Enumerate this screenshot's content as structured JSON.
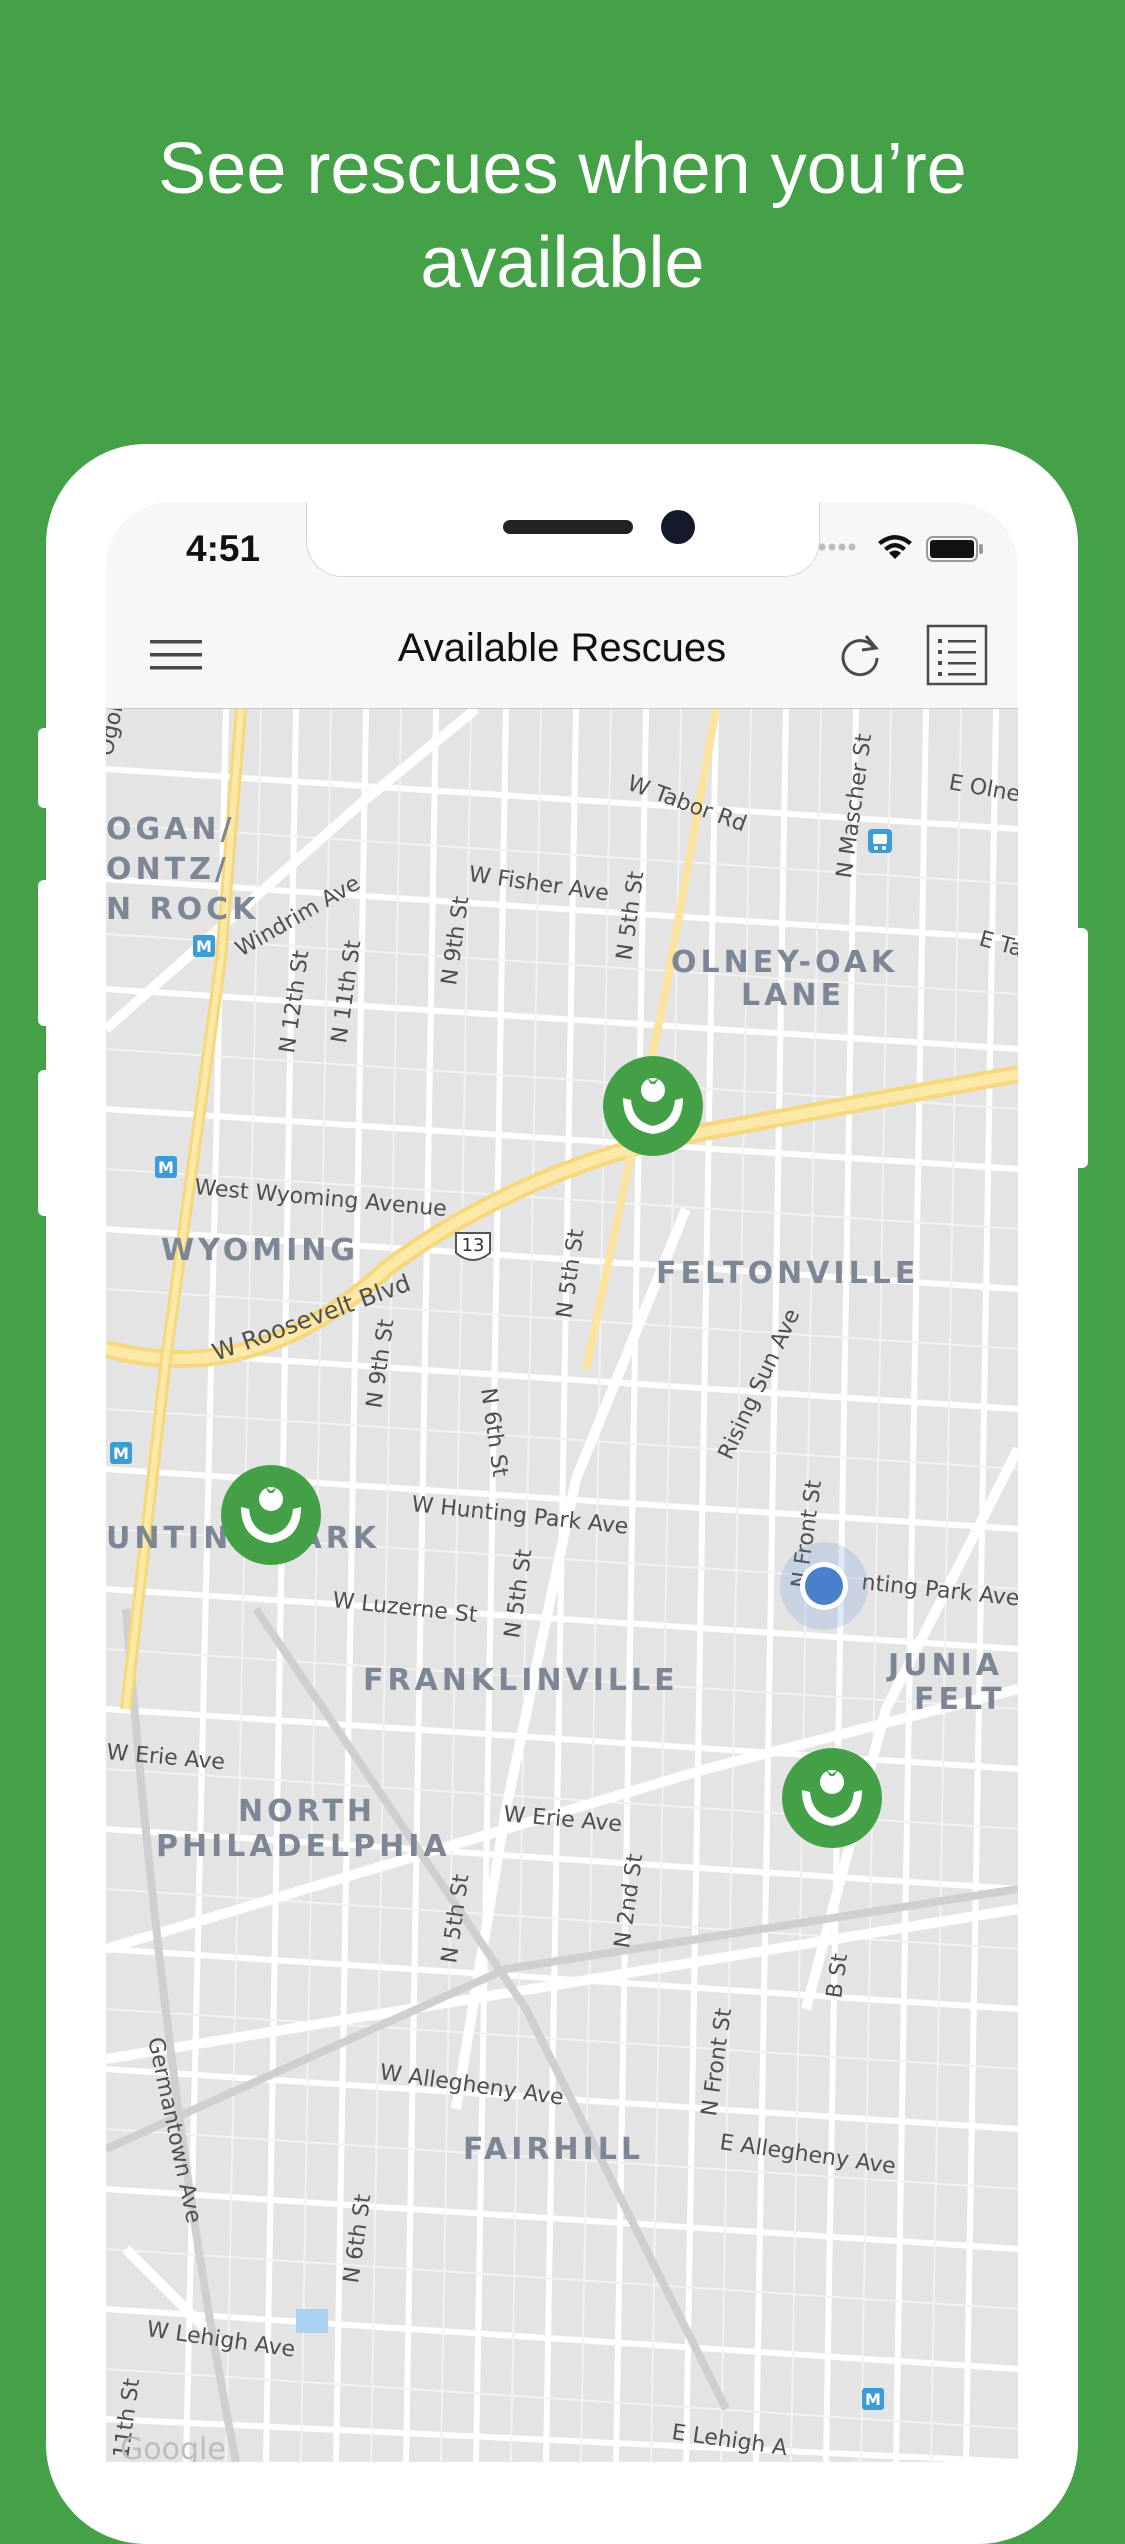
{
  "headline": {
    "line1": "See rescues when you’re",
    "line2": "available"
  },
  "status_bar": {
    "time": "4:51"
  },
  "nav": {
    "title": "Available Rescues",
    "menu_icon": "hamburger-menu-icon",
    "refresh_icon": "refresh-icon",
    "list_icon": "list-view-icon"
  },
  "colors": {
    "brand_green": "#44a148",
    "pin_green": "#43a047",
    "user_location_blue": "#4a7fcb"
  },
  "map": {
    "neighborhoods": {
      "logan_1": "OGAN/",
      "logan_2": "ONTZ/",
      "logan_3": "N ROCK",
      "olney_1": "OLNEY-OAK",
      "olney_2": "LANE",
      "wyoming": "WYOMING",
      "feltonville": "FELTONVILLE",
      "hunting_park": "UNTING PARK",
      "franklinville": "FRANKLINVILLE",
      "juniata_1": "JUNIA",
      "juniata_2": "FELT",
      "north_philly_1": "NORTH",
      "north_philly_2": "PHILADELPHIA",
      "fairhill": "FAIRHILL"
    },
    "streets": {
      "ogon": "Ogon",
      "w_tabor": "W Tabor Rd",
      "e_olney": "E Olne",
      "n_mascher": "N Mascher St",
      "e_ta": "E Ta",
      "w_fisher": "W Fisher Ave",
      "windrim": "Windrim Ave",
      "n_9th_top": "N 9th St",
      "n_5th_top": "N 5th St",
      "n_12th": "N 12th St",
      "n_11th": "N 11th St",
      "west_wyoming": "West Wyoming Avenue",
      "route_13": "13",
      "w_roosevelt": "W Roosevelt Blvd",
      "n_5th_mid": "N 5th St",
      "n_9th_mid": "N 9th St",
      "n_6th_mid": "N 6th St",
      "rising_sun": "Rising Sun Ave",
      "n_front_top": "N Front St",
      "w_hunting_park": "W Hunting Park Ave",
      "hunting_park_e": "nting Park Ave",
      "w_luzerne": "W Luzerne St",
      "n_5th_low": "N 5th St",
      "w_erie_left": "W Erie Ave",
      "w_erie": "W Erie Ave",
      "n_2nd": "N 2nd St",
      "n_5th_lower": "N 5th St",
      "b_st": "B St",
      "n_front_bottom": "N Front St",
      "germantown": "Germantown Ave",
      "w_allegheny": "W Allegheny Ave",
      "e_allegheny": "E Allegheny Ave",
      "n_6th_bottom": "N 6th St",
      "w_lehigh": "W Lehigh Ave",
      "e_lehigh": "E Lehigh A",
      "n_11th_bottom": "11th St",
      "google": "Google"
    },
    "transit_marker": "M",
    "pins": [
      {
        "name": "rescue-pin-olney",
        "icon": "hands-holding-produce-icon"
      },
      {
        "name": "rescue-pin-hunting-park",
        "icon": "hands-holding-produce-icon"
      },
      {
        "name": "rescue-pin-juniata",
        "icon": "hands-holding-produce-icon"
      }
    ],
    "user_location": "current-location-dot"
  }
}
